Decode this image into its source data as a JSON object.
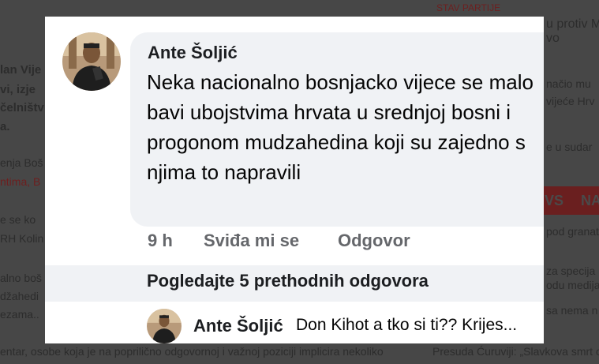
{
  "background": {
    "lines": [
      "STAV PARTIJE",
      "u protiv Me",
      "vo",
      "lan Vije",
      "vi, izje",
      "čelništv",
      "a.",
      "načio mu",
      "vijeće Hrv",
      "e u sudar",
      "enja Boš",
      "ntima, B",
      "VS",
      "NA",
      "e se ko",
      "RH Kolin",
      "pod granat",
      "alno boš",
      "džahedi",
      "ezama..",
      "za specija",
      "odu medija",
      "sa nema n",
      "entar, osobe koja je na poprilično odgovornoj i važnoj poziciji implicira nekoliko",
      "Presuda Ćuruviji: „Slavkova smrt o"
    ]
  },
  "comment": {
    "author": "Ante Šoljić",
    "text": "Neka nacionalno bosnjacko vijece se malo bavi ubojstvima hrvata u srednjoj bosni i progonom mudzahedina koji su zajedno s njima to napravili",
    "time": "9 h",
    "like_label": "Sviđa mi se",
    "reply_label": "Odgovor"
  },
  "view_previous": "Pogledajte 5 prethodnih odgovora",
  "reply": {
    "author": "Ante Šoljić",
    "text": "Don Kihot a tko si ti?? Krijes..."
  },
  "colors": {
    "bubble": "#f0f2f5",
    "secondary_text": "#65676b",
    "overlay": "#3f3f3f"
  }
}
